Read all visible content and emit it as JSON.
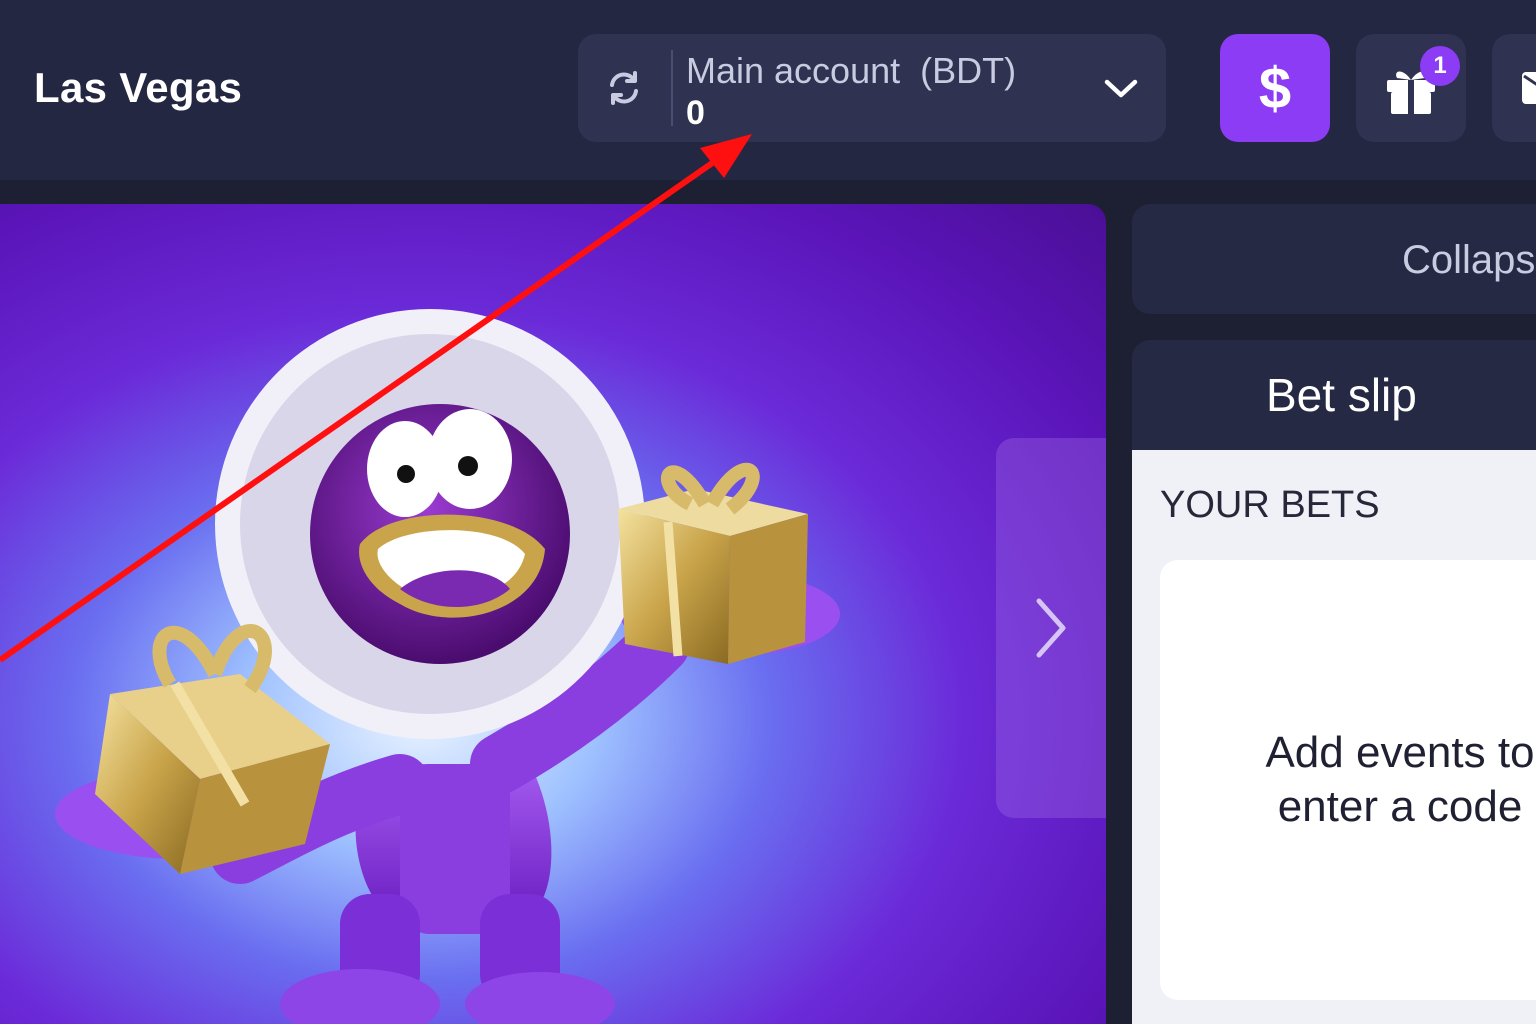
{
  "header": {
    "title": "Las Vegas",
    "account": {
      "label": "Main account  (BDT)",
      "balance": "0"
    },
    "deposit_glyph": "$",
    "gift_badge_count": "1"
  },
  "banner": {
    "icons": [
      "mascot",
      "gift-box",
      "gift-box",
      "chevron-right-icon"
    ]
  },
  "right_panel": {
    "collapse_label": "Collaps",
    "betslip_title": "Bet slip",
    "your_bets_label": "YOUR BETS",
    "empty_line1": "Add events to",
    "empty_line2": "enter a code"
  },
  "colors": {
    "header_bg": "#242741",
    "accent": "#8c3cf5",
    "annotation_arrow": "#ff1010"
  }
}
